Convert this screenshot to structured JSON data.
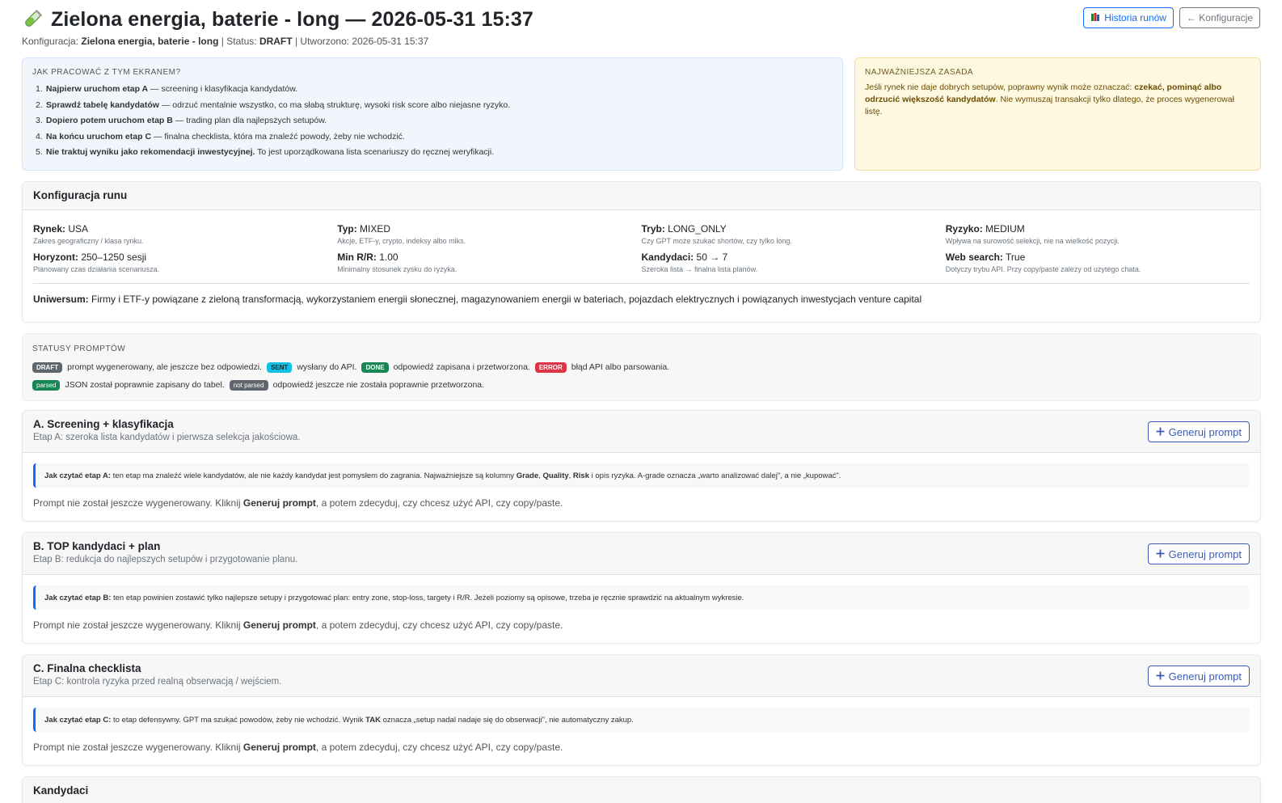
{
  "header": {
    "title": "Zielona energia, baterie - long — 2026-05-31 15:37",
    "meta_config_label": "Konfiguracja:",
    "meta_config_value": "Zielona energia, baterie - long",
    "meta_status_label": "| Status:",
    "meta_status_value": "DRAFT",
    "meta_created": "| Utworzono: 2026-05-31 15:37",
    "btn_history": "Historia runów",
    "btn_back": "← Konfiguracje"
  },
  "howto": {
    "heading": "Jak pracować z tym ekranem?",
    "steps": [
      {
        "num": "1.",
        "bold": "Najpierw uruchom etap A",
        "rest": " — screening i klasyfikacja kandydatów."
      },
      {
        "num": "2.",
        "bold": "Sprawdź tabelę kandydatów",
        "rest": " — odrzuć mentalnie wszystko, co ma słabą strukturę, wysoki risk score albo niejasne ryzyko."
      },
      {
        "num": "3.",
        "bold": "Dopiero potem uruchom etap B",
        "rest": " — trading plan dla najlepszych setupów."
      },
      {
        "num": "4.",
        "bold": "Na końcu uruchom etap C",
        "rest": " — finalna checklista, która ma znaleźć powody, żeby nie wchodzić."
      },
      {
        "num": "5.",
        "bold": "Nie traktuj wyniku jako rekomendacji inwestycyjnej.",
        "rest": " To jest uporządkowana lista scenariuszy do ręcznej weryfikacji."
      }
    ]
  },
  "rule": {
    "heading": "Najważniejsza zasada",
    "text_1": "Jeśli rynek nie daje dobrych setupów, poprawny wynik może oznaczać: ",
    "text_bold": "czekać, pominąć albo odrzucić większość kandydatów",
    "text_2": ". Nie wymuszaj transakcji tylko dlatego, że proces wygenerował listę."
  },
  "config": {
    "title": "Konfiguracja runu",
    "items": [
      {
        "k": "Rynek:",
        "v": " USA",
        "d": "Zakres geograficzny / klasa rynku."
      },
      {
        "k": "Typ:",
        "v": " MIXED",
        "d": "Akcje, ETF-y, crypto, indeksy albo miks."
      },
      {
        "k": "Tryb:",
        "v": " LONG_ONLY",
        "d": "Czy GPT może szukać shortów, czy tylko long."
      },
      {
        "k": "Ryzyko:",
        "v": " MEDIUM",
        "d": "Wpływa na surowość selekcji, nie na wielkość pozycji."
      },
      {
        "k": "Horyzont:",
        "v": " 250–1250 sesji",
        "d": "Planowany czas działania scenariusza."
      },
      {
        "k": "Min R/R:",
        "v": " 1.00",
        "d": "Minimalny stosunek zysku do ryzyka."
      },
      {
        "k": "Kandydaci:",
        "v": " 50 → 7",
        "d": "Szeroka lista → finalna lista planów."
      },
      {
        "k": "Web search:",
        "v": " True",
        "d": "Dotyczy trybu API. Przy copy/paste zależy od użytego chata."
      }
    ],
    "universe_label": "Uniwersum:",
    "universe_value": " Firmy i ETF-y powiązane z zieloną transformacją, wykorzystaniem energii słonecznej, magazynowaniem energii w bateriach, pojazdach elektrycznych i powiązanych inwestycjach venture capital"
  },
  "statuses": {
    "heading": "Statusy promptów",
    "draft": "DRAFT",
    "draft_desc": "prompt wygenerowany, ale jeszcze bez odpowiedzi.",
    "sent": "SENT",
    "sent_desc": "wysłany do API.",
    "done": "DONE",
    "done_desc": "odpowiedź zapisana i przetworzona.",
    "error": "ERROR",
    "error_desc": "błąd API albo parsowania.",
    "parsed": "parsed",
    "parsed_desc": "JSON został poprawnie zapisany do tabel.",
    "not_parsed": "not parsed",
    "not_parsed_desc": "odpowiedź jeszcze nie została poprawnie przetworzona."
  },
  "stages": {
    "generate_label": "Generuj prompt",
    "note_1": "Prompt nie został jeszcze wygenerowany. Kliknij ",
    "note_bold": "Generuj prompt",
    "note_2": ", a potem zdecyduj, czy chcesz użyć API, czy copy/paste.",
    "a": {
      "title": "A. Screening + klasyfikacja",
      "sub": "Etap A: szeroka lista kandydatów i pierwsza selekcja jakościowa.",
      "callout_label": "Jak czytać etap A:",
      "callout_1": " ten etap ma znaleźć wiele kandydatów, ale nie każdy kandydat jest pomysłem do zagrania. Najważniejsze są kolumny ",
      "grade": "Grade",
      "sep1": ", ",
      "quality": "Quality",
      "sep2": ", ",
      "risk": "Risk",
      "callout_2": " i opis ryzyka. A-grade oznacza „warto analizować dalej\", a nie „kupować\"."
    },
    "b": {
      "title": "B. TOP kandydaci + plan",
      "sub": "Etap B: redukcja do najlepszych setupów i przygotowanie planu.",
      "callout_label": "Jak czytać etap B:",
      "callout_1": " ten etap powinien zostawić tylko najlepsze setupy i przygotować plan: entry zone, stop-loss, targety i R/R. Jeżeli poziomy są opisowe, trzeba je ręcznie sprawdzić na aktualnym wykresie."
    },
    "c": {
      "title": "C. Finalna checklista",
      "sub": "Etap C: kontrola ryzyka przed realną obserwacją / wejściem.",
      "callout_label": "Jak czytać etap C:",
      "callout_1": " to etap defensywny. GPT ma szukać powodów, żeby nie wchodzić. Wynik ",
      "tak": "TAK",
      "callout_2": " oznacza „setup nadal nadaje się do obserwacji\", nie automatyczny zakup."
    }
  },
  "candidates": {
    "title": "Kandydaci"
  },
  "colors": {
    "primary": "#0d6efd",
    "info_bg": "#f1f6fd",
    "warning_bg": "#fff8e1",
    "warning_text": "#6b4e00"
  },
  "icons": {
    "title": "test-tube-icon",
    "history": "books-icon",
    "generate": "plus-icon"
  }
}
